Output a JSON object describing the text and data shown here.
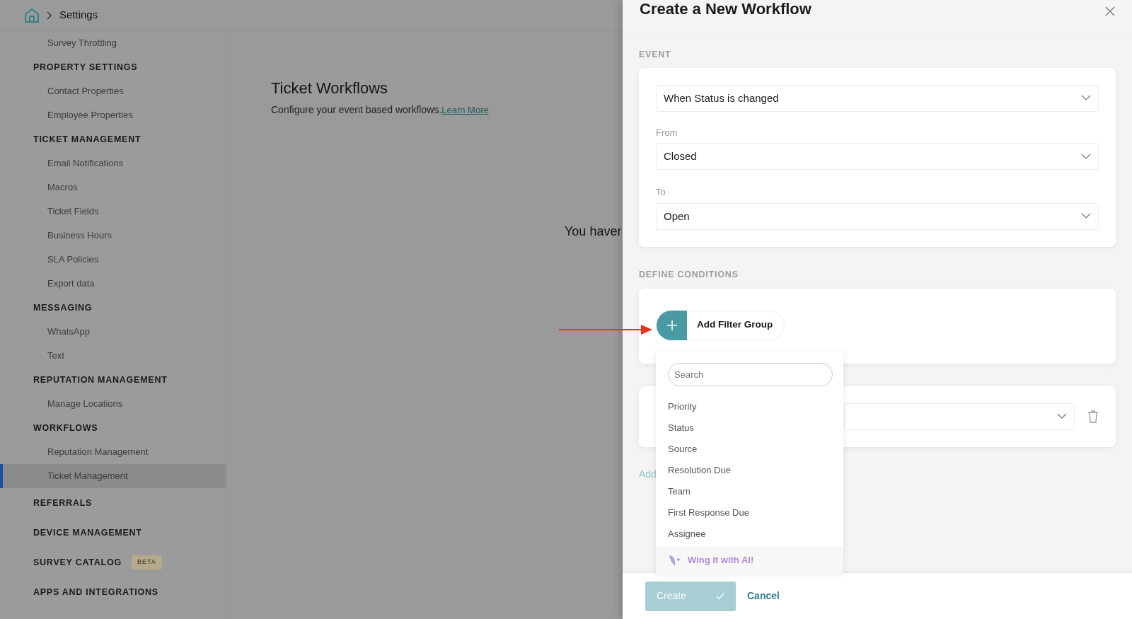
{
  "breadcrumb": {
    "current": "Settings"
  },
  "sidebar": {
    "items": [
      {
        "kind": "item",
        "label": "Survey Throttling",
        "selected": false
      },
      {
        "kind": "section",
        "label": "PROPERTY SETTINGS"
      },
      {
        "kind": "item",
        "label": "Contact Properties",
        "selected": false
      },
      {
        "kind": "item",
        "label": "Employee Properties",
        "selected": false
      },
      {
        "kind": "section",
        "label": "TICKET MANAGEMENT"
      },
      {
        "kind": "item",
        "label": "Email Notifications",
        "selected": false
      },
      {
        "kind": "item",
        "label": "Macros",
        "selected": false
      },
      {
        "kind": "item",
        "label": "Ticket Fields",
        "selected": false
      },
      {
        "kind": "item",
        "label": "Business Hours",
        "selected": false
      },
      {
        "kind": "item",
        "label": "SLA Policies",
        "selected": false
      },
      {
        "kind": "item",
        "label": "Export data",
        "selected": false
      },
      {
        "kind": "section",
        "label": "MESSAGING"
      },
      {
        "kind": "item",
        "label": "WhatsApp",
        "selected": false
      },
      {
        "kind": "item",
        "label": "Text",
        "selected": false
      },
      {
        "kind": "section",
        "label": "REPUTATION MANAGEMENT"
      },
      {
        "kind": "item",
        "label": "Manage Locations",
        "selected": false
      },
      {
        "kind": "section",
        "label": "WORKFLOWS"
      },
      {
        "kind": "item",
        "label": "Reputation Management",
        "selected": false
      },
      {
        "kind": "item",
        "label": "Ticket Management",
        "selected": true
      },
      {
        "kind": "link",
        "label": "REFERRALS"
      },
      {
        "kind": "link",
        "label": "DEVICE MANAGEMENT"
      },
      {
        "kind": "link",
        "label": "SURVEY CATALOG",
        "badge": "BETA"
      },
      {
        "kind": "link",
        "label": "APPS AND INTEGRATIONS"
      }
    ]
  },
  "page": {
    "title": "Ticket Workflows",
    "description": "Configure your event based workflows.",
    "link": "Learn More",
    "empty_message": "You haver"
  },
  "drawer": {
    "title": "Create a New Workflow",
    "event_label": "EVENT",
    "event_select": "When Status is changed",
    "from_label": "From",
    "from_select": "Closed",
    "to_label": "To",
    "to_select": "Open",
    "conditions_label": "DEFINE CONDITIONS",
    "add_filter_group": "Add Filter Group",
    "add_link": "Add",
    "create_button": {
      "label": "Create",
      "disabled": true
    },
    "cancel": "Cancel"
  },
  "filter_menu": {
    "placeholder": "Search",
    "options": [
      "Priority",
      "Status",
      "Source",
      "Resolution Due",
      "Team",
      "First Response Due",
      "Assignee"
    ],
    "ai_option": "Wing it with AI!"
  }
}
